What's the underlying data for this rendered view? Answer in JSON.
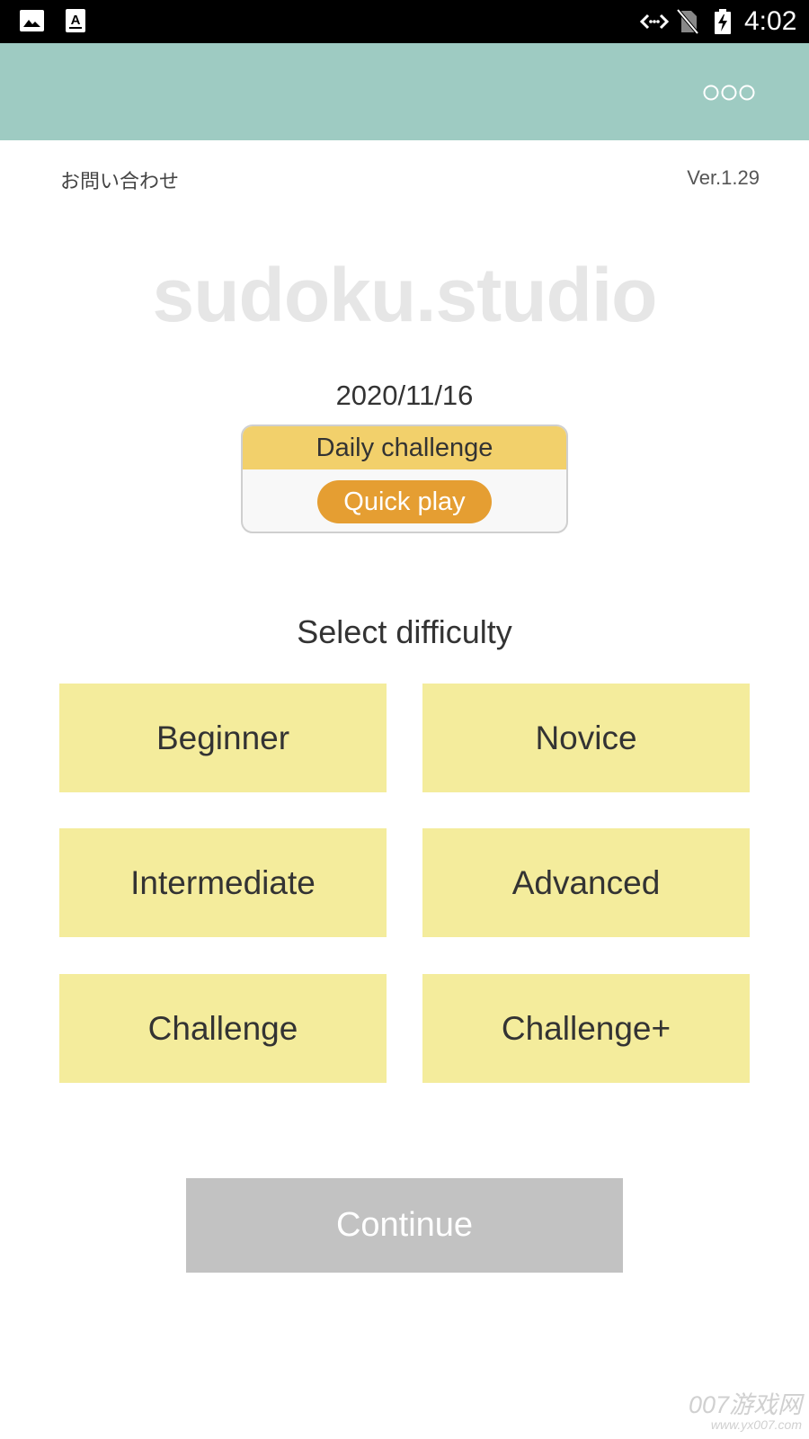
{
  "status_bar": {
    "time": "4:02",
    "icons": [
      "image-icon",
      "font-icon",
      "network-icon",
      "no-sim-icon",
      "battery-charging-icon"
    ]
  },
  "app_bar": {
    "background": "#9ecbc2",
    "menu_icon": "more-icon"
  },
  "header": {
    "contact_label": "お問い合わせ",
    "version": "Ver.1.29"
  },
  "logo": {
    "text": "sudoku.studio"
  },
  "daily": {
    "date": "2020/11/16",
    "title": "Daily challenge",
    "quick_play_label": "Quick play",
    "header_color": "#f2d06b",
    "button_color": "#e59e32"
  },
  "difficulty": {
    "title": "Select difficulty",
    "options": [
      "Beginner",
      "Novice",
      "Intermediate",
      "Advanced",
      "Challenge",
      "Challenge+"
    ],
    "button_color": "#f4ec9c"
  },
  "continue": {
    "label": "Continue",
    "enabled": false,
    "color": "#c2c2c2"
  },
  "watermark": {
    "line1": "007游戏网",
    "line2": "www.yx007.com"
  }
}
